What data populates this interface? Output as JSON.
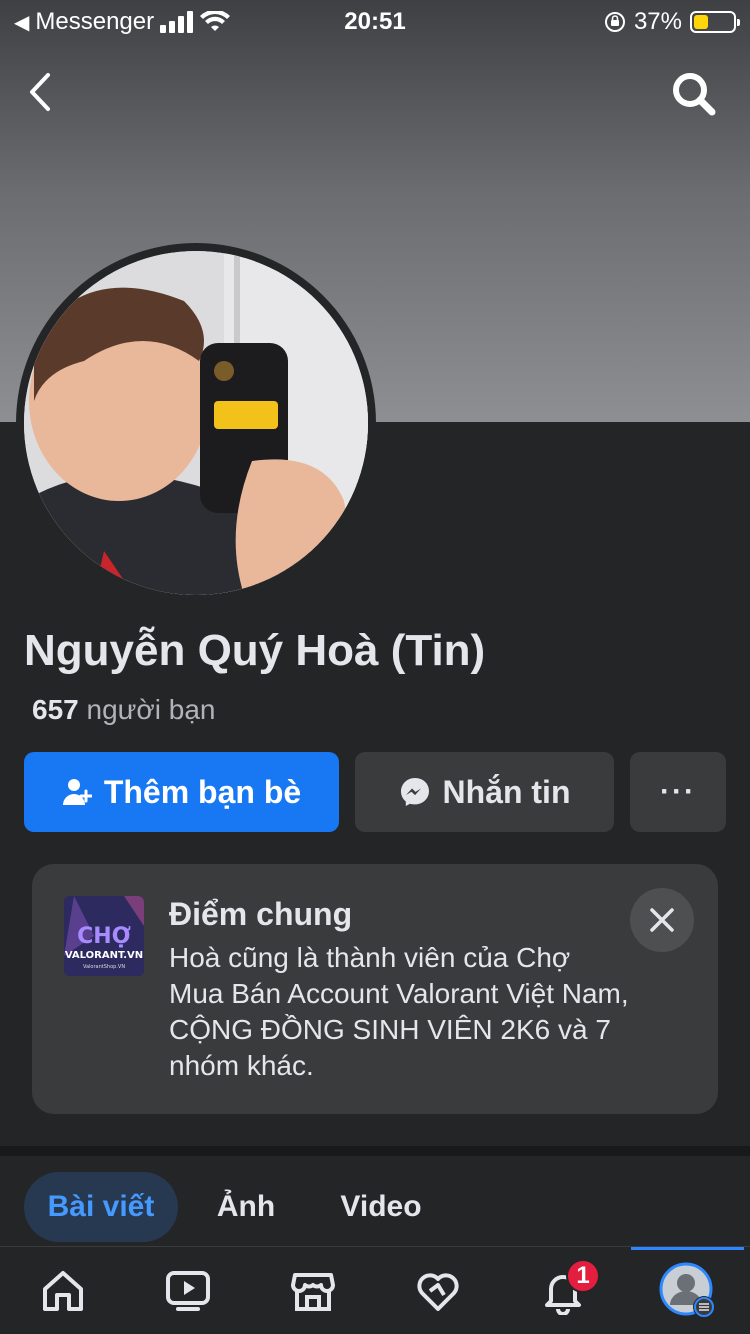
{
  "status_bar": {
    "back_app": "Messenger",
    "time": "20:51",
    "battery": "37%",
    "battery_level": 0.37
  },
  "profile": {
    "name": "Nguyễn Quý Hoà (Tin)",
    "friend_count": "657",
    "friend_label": "người bạn"
  },
  "actions": {
    "add_friend": "Thêm bạn bè",
    "message": "Nhắn tin",
    "more": "···"
  },
  "mutual": {
    "title": "Điểm chung",
    "text": "Hoà cũng là thành viên của Chợ Mua Bán Account Valorant Việt Nam, CỘNG ĐỒNG SINH VIÊN 2K6 và 7 nhóm khác.",
    "thumb_text": "CHỢ",
    "thumb_sub": "VALORANT.VN",
    "thumb_caption": "ValorantShop.VN"
  },
  "tabs": [
    {
      "label": "Bài viết",
      "active": true
    },
    {
      "label": "Ảnh",
      "active": false
    },
    {
      "label": "Video",
      "active": false
    }
  ],
  "bottom_nav": {
    "items": [
      "home-icon",
      "video-icon",
      "marketplace-icon",
      "dating-icon",
      "notifications-icon",
      "profile-menu-icon"
    ],
    "notification_count": "1",
    "accent": "#2d88ff"
  },
  "colors": {
    "primary": "#1877f2",
    "background": "#242526",
    "badge": "#e41e3f"
  }
}
